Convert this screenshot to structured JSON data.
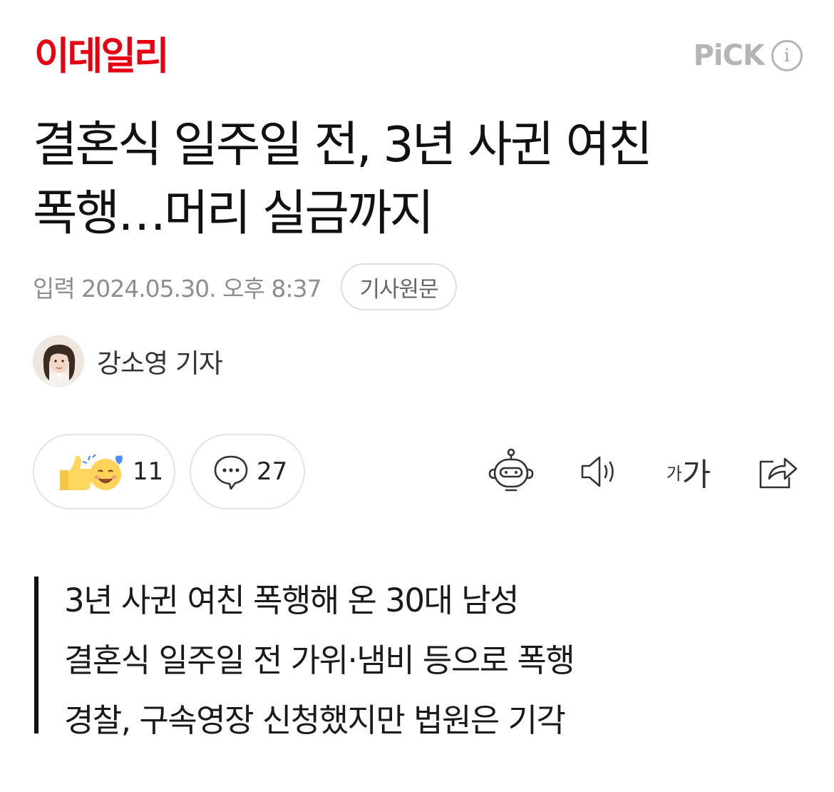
{
  "header": {
    "logo_text": "이데일리",
    "pick_label": "PiCK",
    "info_icon_text": "i",
    "brand_color": "#e60012"
  },
  "article": {
    "headline_line1": "결혼식 일주일 전, 3년 사귄 여친",
    "headline_line2": "폭행…머리 실금까지",
    "date_text": "입력 2024.05.30. 오후 8:37",
    "original_button": "기사원문",
    "author_name": "강소영 기자"
  },
  "actions": {
    "reaction_count": "11",
    "comment_count": "27",
    "font_small": "가",
    "font_big": "가",
    "icons": [
      "thumbs-up-emoji-icon",
      "smile-emoji-icon",
      "comment-bubble-icon",
      "robot-icon",
      "speaker-icon",
      "font-size-icon",
      "share-icon"
    ]
  },
  "summary": {
    "lines": [
      "3년 사귄 여친 폭행해 온 30대 남성",
      "결혼식 일주일 전 가위·냄비 등으로 폭행",
      "경찰, 구속영장 신청했지만 법원은 기각"
    ]
  }
}
